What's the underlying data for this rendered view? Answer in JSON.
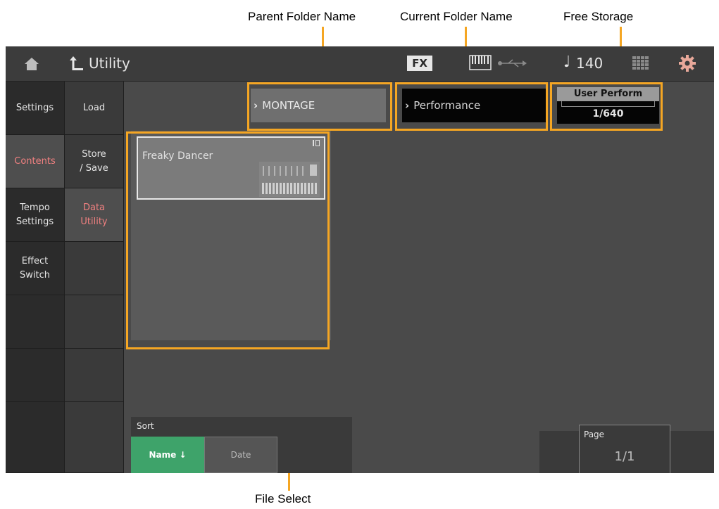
{
  "callouts": {
    "parent": "Parent Folder Name",
    "current": "Current Folder Name",
    "storage": "Free Storage",
    "file_select": "File Select"
  },
  "header": {
    "title": "Utility",
    "fx": "FX",
    "tempo_symbol": "♩",
    "tempo": "140",
    "icons": [
      "home-icon",
      "back-icon",
      "keyboard-icon",
      "usb-icon",
      "grid-icon",
      "gear-icon"
    ]
  },
  "nav_primary": [
    {
      "label": "Settings",
      "selected": false
    },
    {
      "label": "Contents",
      "selected": true
    },
    {
      "label": "Tempo\nSettings",
      "selected": false
    },
    {
      "label": "Effect\nSwitch",
      "selected": false
    },
    {
      "label": "",
      "selected": false
    },
    {
      "label": "",
      "selected": false
    },
    {
      "label": "",
      "selected": false
    }
  ],
  "nav_secondary": [
    {
      "label": "Load",
      "selected": false
    },
    {
      "label": "Store\n/ Save",
      "selected": false
    },
    {
      "label": "Data\nUtility",
      "selected": true
    },
    {
      "label": "",
      "selected": false
    },
    {
      "label": "",
      "selected": false
    },
    {
      "label": "",
      "selected": false
    },
    {
      "label": "",
      "selected": false
    }
  ],
  "folders": {
    "parent": "MONTAGE",
    "current": "Performance",
    "chevron": "›"
  },
  "storage": {
    "label": "User Perform",
    "value": "1/640"
  },
  "files": [
    {
      "name": "Freaky Dancer"
    }
  ],
  "sort": {
    "label": "Sort",
    "name_button": "Name ↓",
    "date_button": "Date",
    "selected": "name"
  },
  "page": {
    "label": "Page",
    "value": "1/1"
  },
  "colors": {
    "accent_callout": "#f5a623",
    "selected_text": "#f08080",
    "sort_active": "#3ea36a"
  }
}
